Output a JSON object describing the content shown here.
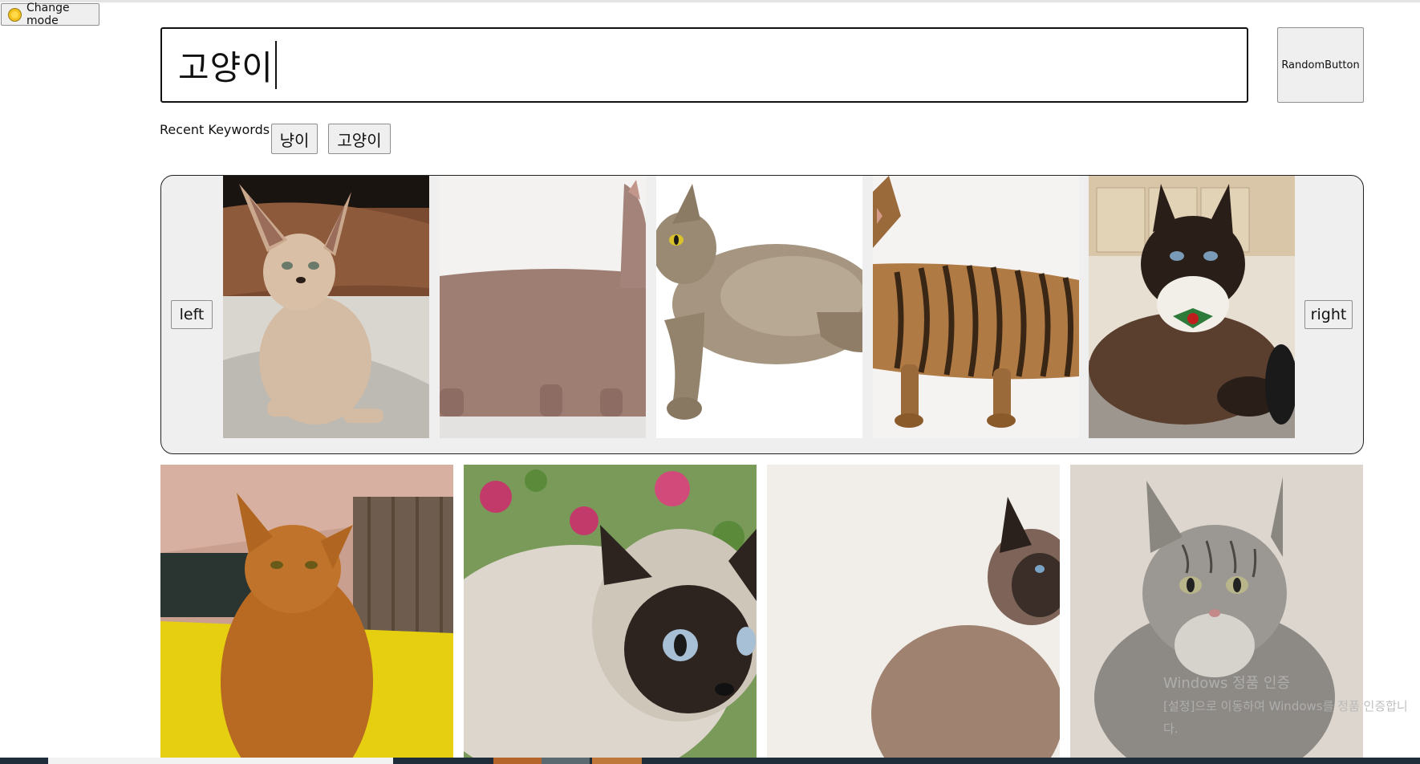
{
  "mode_toggle": {
    "label": "Change mode",
    "icon": "sun-icon"
  },
  "search": {
    "value": "고양이"
  },
  "random_button": {
    "label": "RandomButton"
  },
  "recent": {
    "label": "Recent Keywords :",
    "keywords": [
      "냥이",
      "고양이"
    ]
  },
  "carousel": {
    "left_label": "left",
    "right_label": "right",
    "slides": [
      {
        "subject": "sphynx cat on leather couch"
      },
      {
        "subject": "short-legged brown cat walking"
      },
      {
        "subject": "grey tabby cat lying"
      },
      {
        "subject": "striped tabby cat walking"
      },
      {
        "subject": "snowshoe cat with green bow tie"
      }
    ]
  },
  "gallery": {
    "images": [
      {
        "subject": "orange cat by curtain"
      },
      {
        "subject": "siamese cat close-up with flowers"
      },
      {
        "subject": "siamese cat sitting"
      },
      {
        "subject": "maine coon kitten"
      }
    ]
  },
  "watermark": {
    "line1": "Windows 정품 인증",
    "line2": "[설정]으로 이동하여 Windows를 정품 인증합니다."
  },
  "colors": {
    "carousel_bg": "#efefef",
    "button_bg": "#efefef",
    "border": "#222222"
  }
}
